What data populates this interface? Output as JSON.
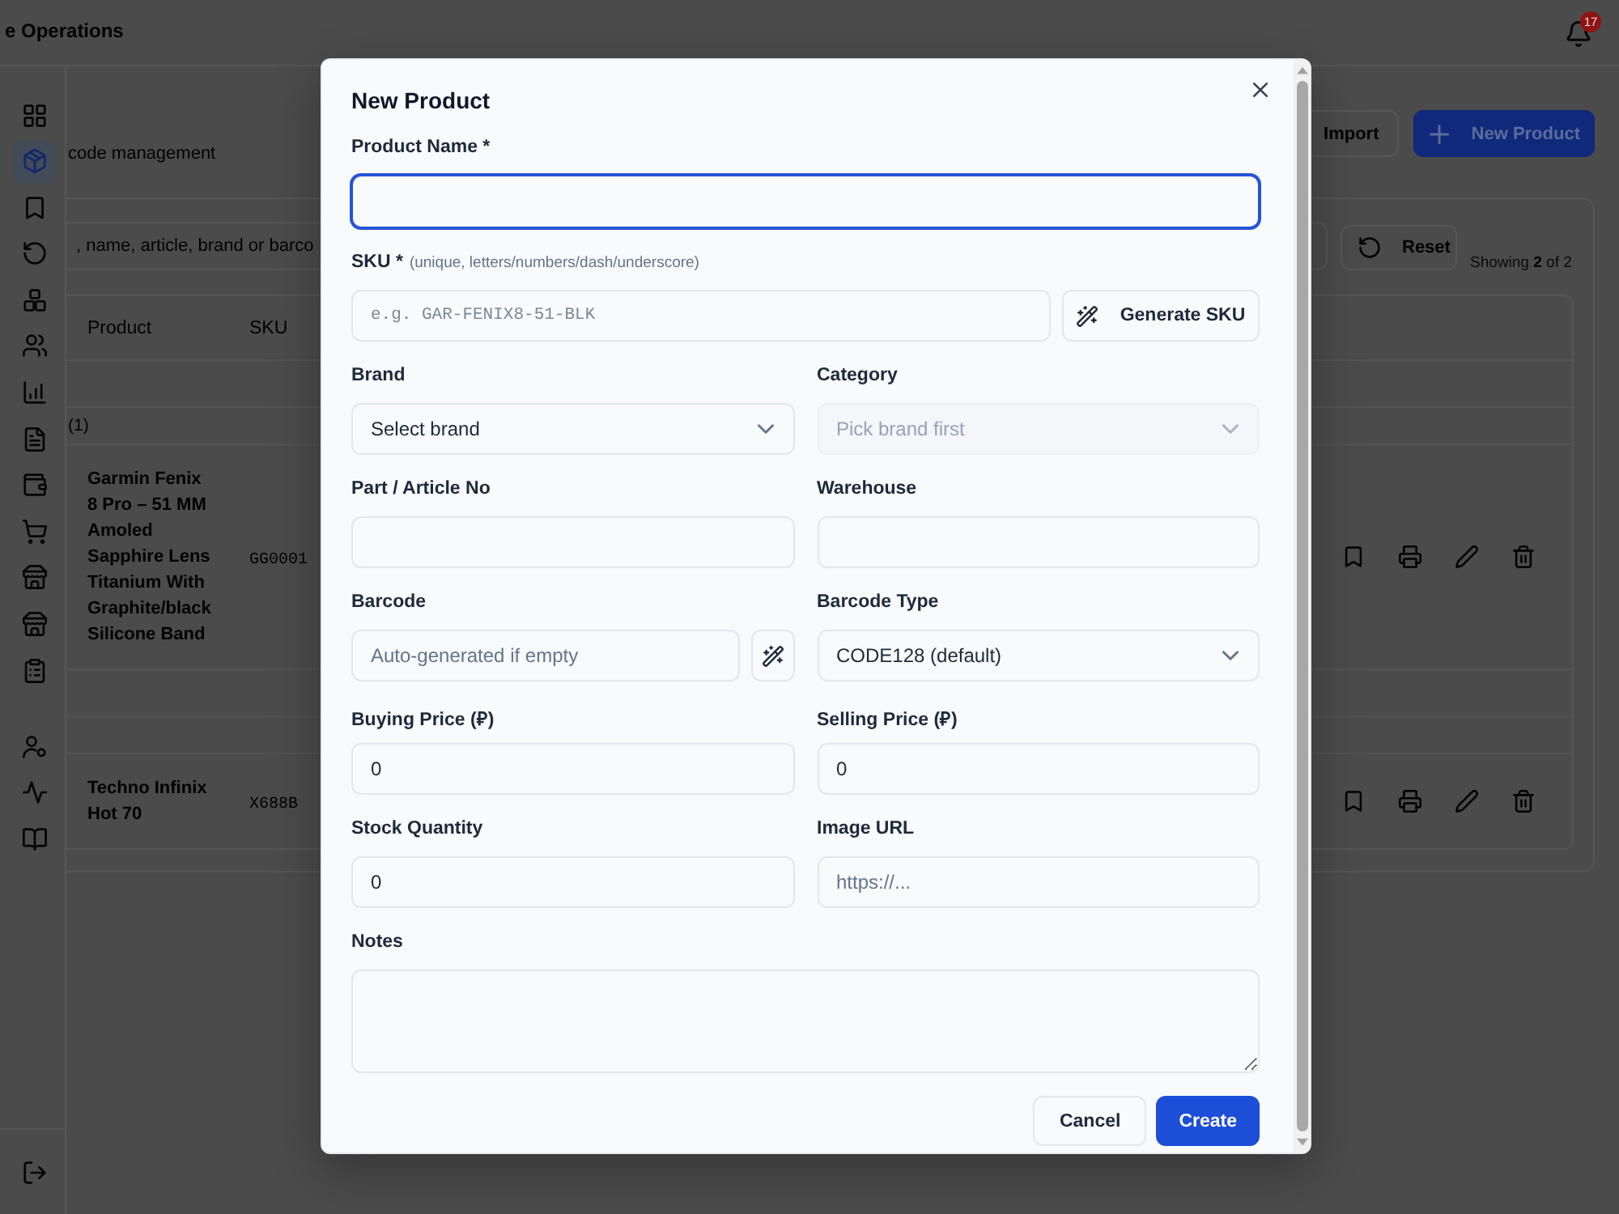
{
  "app_bar": {
    "title": "e Operations",
    "notification_count": "17"
  },
  "sidebar": {
    "items": [
      {
        "selected": false
      },
      {
        "selected": true
      },
      {
        "selected": false
      },
      {
        "selected": false
      },
      {
        "selected": false
      },
      {
        "selected": false
      },
      {
        "selected": false
      },
      {
        "selected": false
      },
      {
        "selected": false
      },
      {
        "selected": false
      },
      {
        "selected": false
      },
      {
        "selected": false
      },
      {
        "selected": false
      }
    ],
    "admin_items": [
      {
        "selected": false
      },
      {
        "selected": false
      },
      {
        "selected": false
      }
    ]
  },
  "page": {
    "subtitle": "code management",
    "actions": [
      {
        "label": "Import",
        "kind": "secondary"
      },
      {
        "label": "New Product",
        "kind": "primary"
      }
    ]
  },
  "filters": {
    "search_placeholder": ", name, article, brand or barco",
    "reset_label": "Reset",
    "result_count": "Showing **2** of 2"
  },
  "table": {
    "columns": [
      "Product",
      "SKU"
    ],
    "groups": [
      {
        "label": "(1)",
        "rows": [
          {
            "product": "Garmin Fenix 8 Pro – 51 MM Amoled Sapphire Lens Titanium With Graphite/black Silicone Band",
            "sku": "GG0001"
          }
        ]
      },
      {
        "rows": [
          {
            "product": "Techno Infinix Hot 70",
            "sku": "X688B"
          }
        ]
      }
    ]
  },
  "modal": {
    "title": "New Product",
    "form_rows": [
      {
        "fields": [
          {
            "kind": "text",
            "label": "Product Name *",
            "focused": true,
            "disabled": false
          }
        ]
      },
      {
        "fields": [
          {
            "kind": "code",
            "label": "SKU *",
            "hint": "(unique, letters/numbers/dash/underscore)",
            "placeholder": "e.g. GAR-FENIX8-51-BLK",
            "button": "Generate SKU",
            "focused": false,
            "disabled": false
          }
        ]
      },
      {
        "fields": [
          {
            "kind": "select",
            "label": "Brand",
            "value": "Select brand",
            "focused": false,
            "disabled": false
          },
          {
            "kind": "select",
            "label": "Category",
            "value": "Pick brand first",
            "focused": false,
            "disabled": true
          }
        ]
      },
      {
        "fields": [
          {
            "kind": "text",
            "label": "Part / Article No",
            "focused": false
          },
          {
            "kind": "text",
            "label": "Warehouse",
            "focused": false
          }
        ]
      },
      {
        "fields": [
          {
            "kind": "text",
            "label": "Barcode",
            "placeholder": "Auto-generated if empty",
            "icon_button": true,
            "focused": false,
            "disabled": false
          },
          {
            "kind": "select",
            "label": "Barcode Type",
            "value": "CODE128 (default)",
            "focused": false,
            "disabled": false
          }
        ]
      },
      {
        "fields": [
          {
            "kind": "text",
            "label": "Buying Price (₽)",
            "value": "0",
            "focused": false,
            "disabled": false
          },
          {
            "kind": "text",
            "label": "Selling Price (₽)",
            "value": "0",
            "focused": false,
            "disabled": false
          }
        ]
      },
      {
        "fields": [
          {
            "kind": "text",
            "label": "Stock Quantity",
            "value": "0",
            "focused": false,
            "disabled": false
          },
          {
            "kind": "text",
            "label": "Image URL",
            "placeholder": "https://...",
            "focused": false,
            "disabled": false
          }
        ]
      },
      {
        "fields": [
          {
            "kind": "textarea",
            "label": "Notes",
            "focused": false
          }
        ]
      }
    ],
    "buttons": [
      {
        "label": "Cancel",
        "kind": "secondary"
      },
      {
        "label": "Create",
        "kind": "primary"
      }
    ]
  }
}
